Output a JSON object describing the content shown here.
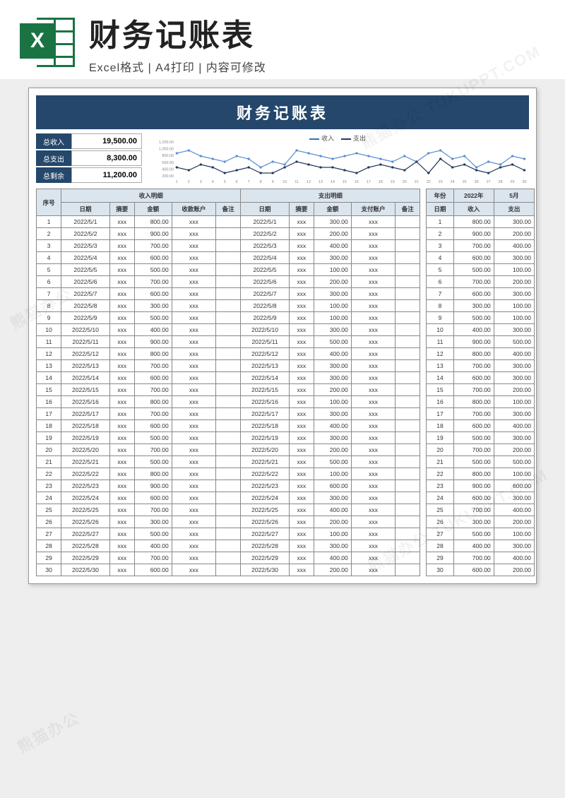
{
  "header": {
    "title": "财务记账表",
    "subtitle": "Excel格式 | A4打印 | 内容可修改",
    "icon_letter": "X"
  },
  "sheet": {
    "title": "财务记账表",
    "summary": {
      "income_label": "总收入",
      "income_value": "19,500.00",
      "expense_label": "总支出",
      "expense_value": "8,300.00",
      "balance_label": "总剩余",
      "balance_value": "11,200.00"
    },
    "chart": {
      "legend_income": "收入",
      "legend_expense": "支出",
      "y_labels": [
        "1,200.00",
        "1,000.00",
        "800.00",
        "600.00",
        "400.00",
        "200.00"
      ]
    },
    "left_columns": {
      "seq": "序号",
      "income_group": "收入明细",
      "expense_group": "支出明细",
      "date": "日期",
      "summary": "摘要",
      "amount": "金额",
      "account_in": "收款账户",
      "account_out": "支付账户",
      "remark": "备注"
    },
    "right_columns": {
      "year_label": "年份",
      "year_value": "2022年",
      "month_value": "5月",
      "date": "日期",
      "income": "收入",
      "expense": "支出"
    },
    "rows": [
      {
        "n": 1,
        "d": "2022/5/1",
        "in": "800.00",
        "out": "300.00"
      },
      {
        "n": 2,
        "d": "2022/5/2",
        "in": "900.00",
        "out": "200.00"
      },
      {
        "n": 3,
        "d": "2022/5/3",
        "in": "700.00",
        "out": "400.00"
      },
      {
        "n": 4,
        "d": "2022/5/4",
        "in": "600.00",
        "out": "300.00"
      },
      {
        "n": 5,
        "d": "2022/5/5",
        "in": "500.00",
        "out": "100.00"
      },
      {
        "n": 6,
        "d": "2022/5/6",
        "in": "700.00",
        "out": "200.00"
      },
      {
        "n": 7,
        "d": "2022/5/7",
        "in": "600.00",
        "out": "300.00"
      },
      {
        "n": 8,
        "d": "2022/5/8",
        "in": "300.00",
        "out": "100.00"
      },
      {
        "n": 9,
        "d": "2022/5/9",
        "in": "500.00",
        "out": "100.00"
      },
      {
        "n": 10,
        "d": "2022/5/10",
        "in": "400.00",
        "out": "300.00"
      },
      {
        "n": 11,
        "d": "2022/5/11",
        "in": "900.00",
        "out": "500.00"
      },
      {
        "n": 12,
        "d": "2022/5/12",
        "in": "800.00",
        "out": "400.00"
      },
      {
        "n": 13,
        "d": "2022/5/13",
        "in": "700.00",
        "out": "300.00"
      },
      {
        "n": 14,
        "d": "2022/5/14",
        "in": "600.00",
        "out": "300.00"
      },
      {
        "n": 15,
        "d": "2022/5/15",
        "in": "700.00",
        "out": "200.00"
      },
      {
        "n": 16,
        "d": "2022/5/16",
        "in": "800.00",
        "out": "100.00"
      },
      {
        "n": 17,
        "d": "2022/5/17",
        "in": "700.00",
        "out": "300.00"
      },
      {
        "n": 18,
        "d": "2022/5/18",
        "in": "600.00",
        "out": "400.00"
      },
      {
        "n": 19,
        "d": "2022/5/19",
        "in": "500.00",
        "out": "300.00"
      },
      {
        "n": 20,
        "d": "2022/5/20",
        "in": "700.00",
        "out": "200.00"
      },
      {
        "n": 21,
        "d": "2022/5/21",
        "in": "500.00",
        "out": "500.00"
      },
      {
        "n": 22,
        "d": "2022/5/22",
        "in": "800.00",
        "out": "100.00"
      },
      {
        "n": 23,
        "d": "2022/5/23",
        "in": "900.00",
        "out": "600.00"
      },
      {
        "n": 24,
        "d": "2022/5/24",
        "in": "600.00",
        "out": "300.00"
      },
      {
        "n": 25,
        "d": "2022/5/25",
        "in": "700.00",
        "out": "400.00"
      },
      {
        "n": 26,
        "d": "2022/5/26",
        "in": "300.00",
        "out": "200.00"
      },
      {
        "n": 27,
        "d": "2022/5/27",
        "in": "500.00",
        "out": "100.00"
      },
      {
        "n": 28,
        "d": "2022/5/28",
        "in": "400.00",
        "out": "300.00"
      },
      {
        "n": 29,
        "d": "2022/5/29",
        "in": "700.00",
        "out": "400.00"
      },
      {
        "n": 30,
        "d": "2022/5/30",
        "in": "600.00",
        "out": "200.00"
      }
    ],
    "placeholder": "xxx"
  },
  "chart_data": {
    "type": "line",
    "title": "",
    "xlabel": "",
    "ylabel": "",
    "ylim": [
      0,
      1200
    ],
    "categories": [
      1,
      2,
      3,
      4,
      5,
      6,
      7,
      8,
      9,
      10,
      11,
      12,
      13,
      14,
      15,
      16,
      17,
      18,
      19,
      20,
      21,
      22,
      23,
      24,
      25,
      26,
      27,
      28,
      29,
      30
    ],
    "series": [
      {
        "name": "收入",
        "values": [
          800,
          900,
          700,
          600,
          500,
          700,
          600,
          300,
          500,
          400,
          900,
          800,
          700,
          600,
          700,
          800,
          700,
          600,
          500,
          700,
          500,
          800,
          900,
          600,
          700,
          300,
          500,
          400,
          700,
          600
        ]
      },
      {
        "name": "支出",
        "values": [
          300,
          200,
          400,
          300,
          100,
          200,
          300,
          100,
          100,
          300,
          500,
          400,
          300,
          300,
          200,
          100,
          300,
          400,
          300,
          200,
          500,
          100,
          600,
          300,
          400,
          200,
          100,
          300,
          400,
          200
        ]
      }
    ]
  },
  "watermarks": [
    "熊猫办公",
    "熊猫办公 TUKUPPT.COM",
    "熊猫办公",
    "熊猫办公 TUKUPPT.COM"
  ]
}
